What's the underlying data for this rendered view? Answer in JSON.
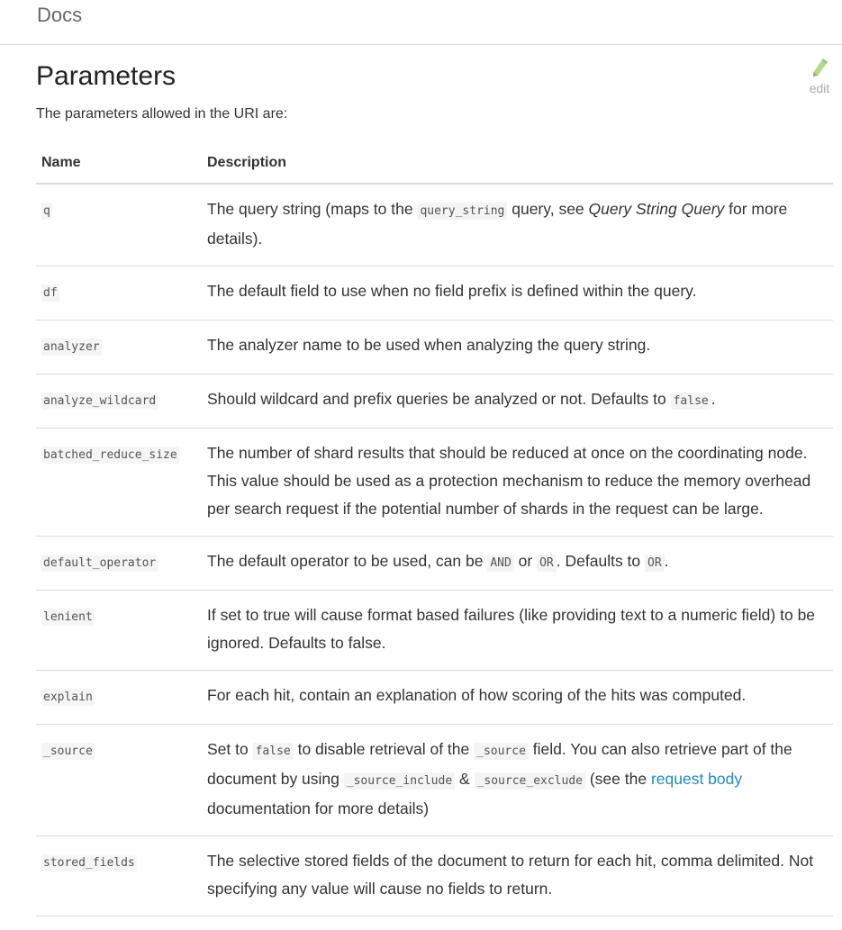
{
  "breadcrumb": "Docs",
  "edit_label": "edit",
  "title": "Parameters",
  "intro": "The parameters allowed in the URI are:",
  "table": {
    "headers": {
      "name": "Name",
      "description": "Description"
    },
    "rows": [
      {
        "name": "q",
        "desc": [
          {
            "t": "text",
            "v": "The query string (maps to the "
          },
          {
            "t": "code",
            "v": "query_string"
          },
          {
            "t": "text",
            "v": " query, see "
          },
          {
            "t": "em",
            "v": "Query String Query"
          },
          {
            "t": "text",
            "v": " for more details)."
          }
        ]
      },
      {
        "name": "df",
        "desc": [
          {
            "t": "text",
            "v": "The default field to use when no field prefix is defined within the query."
          }
        ]
      },
      {
        "name": "analyzer",
        "desc": [
          {
            "t": "text",
            "v": "The analyzer name to be used when analyzing the query string."
          }
        ]
      },
      {
        "name": "analyze_wildcard",
        "desc": [
          {
            "t": "text",
            "v": "Should wildcard and prefix queries be analyzed or not. Defaults to "
          },
          {
            "t": "code",
            "v": "false"
          },
          {
            "t": "text",
            "v": "."
          }
        ]
      },
      {
        "name": "batched_reduce_size",
        "desc": [
          {
            "t": "text",
            "v": "The number of shard results that should be reduced at once on the coordinating node. This value should be used as a protection mechanism to reduce the memory overhead per search request if the potential number of shards in the request can be large."
          }
        ]
      },
      {
        "name": "default_operator",
        "desc": [
          {
            "t": "text",
            "v": "The default operator to be used, can be "
          },
          {
            "t": "code",
            "v": "AND"
          },
          {
            "t": "text",
            "v": " or "
          },
          {
            "t": "code",
            "v": "OR"
          },
          {
            "t": "text",
            "v": ". Defaults to "
          },
          {
            "t": "code",
            "v": "OR"
          },
          {
            "t": "text",
            "v": "."
          }
        ]
      },
      {
        "name": "lenient",
        "desc": [
          {
            "t": "text",
            "v": "If set to true will cause format based failures (like providing text to a numeric field) to be ignored. Defaults to false."
          }
        ]
      },
      {
        "name": "explain",
        "desc": [
          {
            "t": "text",
            "v": "For each hit, contain an explanation of how scoring of the hits was computed."
          }
        ]
      },
      {
        "name": "_source",
        "desc": [
          {
            "t": "text",
            "v": "Set to "
          },
          {
            "t": "code",
            "v": "false"
          },
          {
            "t": "text",
            "v": " to disable retrieval of the "
          },
          {
            "t": "code",
            "v": "_source"
          },
          {
            "t": "text",
            "v": " field. You can also retrieve part of the document by using "
          },
          {
            "t": "code",
            "v": "_source_include"
          },
          {
            "t": "text",
            "v": " & "
          },
          {
            "t": "code",
            "v": "_source_exclude"
          },
          {
            "t": "text",
            "v": " (see the "
          },
          {
            "t": "link",
            "v": "request body"
          },
          {
            "t": "text",
            "v": " documentation for more details)"
          }
        ]
      },
      {
        "name": "stored_fields",
        "desc": [
          {
            "t": "text",
            "v": "The selective stored fields of the document to return for each hit, comma delimited. Not specifying any value will cause no fields to return."
          }
        ]
      }
    ]
  },
  "colors": {
    "link": "#1e8bc3",
    "code_bg": "#f4f4f4",
    "rule": "#dadada"
  },
  "icons": {
    "edit": "pencil-icon"
  }
}
